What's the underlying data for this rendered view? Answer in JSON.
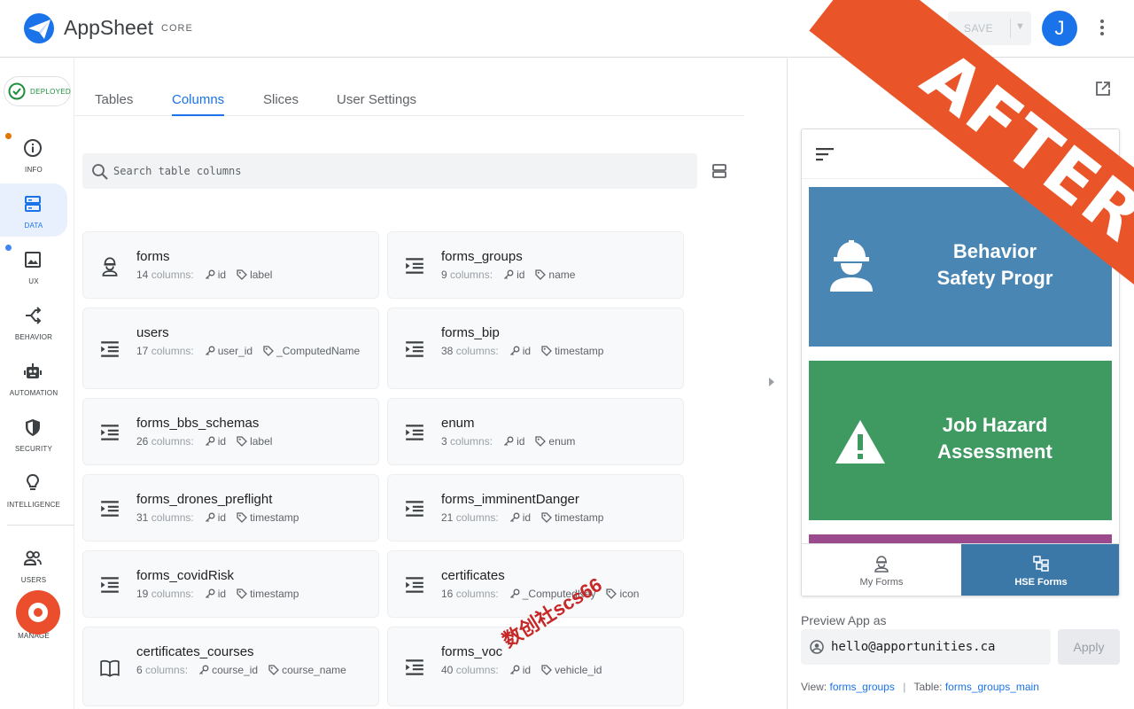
{
  "header": {
    "app_name": "AppSheet",
    "tier": "CORE",
    "save_label": "SAVE",
    "avatar_initial": "J"
  },
  "status": {
    "deployed_label": "DEPLOYED"
  },
  "nav": {
    "items": [
      {
        "label": "INFO",
        "icon": "info-icon"
      },
      {
        "label": "DATA",
        "icon": "data-icon"
      },
      {
        "label": "UX",
        "icon": "image-icon"
      },
      {
        "label": "BEHAVIOR",
        "icon": "behavior-icon"
      },
      {
        "label": "AUTOMATION",
        "icon": "robot-icon"
      },
      {
        "label": "SECURITY",
        "icon": "shield-icon"
      },
      {
        "label": "INTELLIGENCE",
        "icon": "lightbulb-icon"
      },
      {
        "label": "USERS",
        "icon": "users-icon"
      },
      {
        "label": "MANAGE",
        "icon": "manage-icon"
      }
    ]
  },
  "tabs": [
    {
      "label": "Tables"
    },
    {
      "label": "Columns"
    },
    {
      "label": "Slices"
    },
    {
      "label": "User Settings"
    }
  ],
  "search": {
    "placeholder": "Search table columns"
  },
  "tables": [
    {
      "name": "forms",
      "count": "14",
      "key": "id",
      "label_col": "label",
      "icon": "hard-hat-worker-icon"
    },
    {
      "name": "forms_groups",
      "count": "9",
      "key": "id",
      "label_col": "name",
      "icon": "table-rows-icon"
    },
    {
      "name": "users",
      "count": "17",
      "key": "user_id",
      "label_col": "_ComputedName",
      "icon": "table-rows-icon"
    },
    {
      "name": "forms_bip",
      "count": "38",
      "key": "id",
      "label_col": "timestamp",
      "icon": "table-rows-icon"
    },
    {
      "name": "forms_bbs_schemas",
      "count": "26",
      "key": "id",
      "label_col": "label",
      "icon": "table-rows-icon"
    },
    {
      "name": "enum",
      "count": "3",
      "key": "id",
      "label_col": "enum",
      "icon": "table-rows-icon"
    },
    {
      "name": "forms_drones_preflight",
      "count": "31",
      "key": "id",
      "label_col": "timestamp",
      "icon": "table-rows-icon"
    },
    {
      "name": "forms_imminentDanger",
      "count": "21",
      "key": "id",
      "label_col": "timestamp",
      "icon": "table-rows-icon"
    },
    {
      "name": "forms_covidRisk",
      "count": "19",
      "key": "id",
      "label_col": "timestamp",
      "icon": "table-rows-icon"
    },
    {
      "name": "certificates",
      "count": "16",
      "key": "_ComputedKey",
      "label_col": "icon",
      "icon": "table-rows-icon"
    },
    {
      "name": "certificates_courses",
      "count": "6",
      "key": "course_id",
      "label_col": "course_name",
      "icon": "book-icon"
    },
    {
      "name": "forms_voc",
      "count": "40",
      "key": "id",
      "label_col": "vehicle_id",
      "icon": "table-rows-icon"
    }
  ],
  "columns_suffix": "columns:",
  "preview": {
    "tiles": [
      {
        "line1": "Behavior",
        "line2": "Safety Progr",
        "color": "#4a86b4"
      },
      {
        "line1": "Job Hazard",
        "line2": "Assessment",
        "color": "#3f9a62"
      }
    ],
    "bottom_nav": [
      {
        "label": "My Forms",
        "icon": "hard-hat-worker-icon"
      },
      {
        "label": "HSE Forms",
        "icon": "forms-grid-icon"
      }
    ],
    "preview_as_label": "Preview App as",
    "email": "hello@apportunities.ca",
    "apply_label": "Apply",
    "view_label": "View:",
    "view_value": "forms_groups",
    "table_label": "Table:",
    "table_value": "forms_groups_main"
  },
  "banner": {
    "text": "AFTER",
    "color": "#e95528"
  },
  "watermark": {
    "text": "数创社scs66"
  },
  "colors": {
    "accent": "#1a73e8",
    "deployed_green": "#1e8e3e"
  }
}
